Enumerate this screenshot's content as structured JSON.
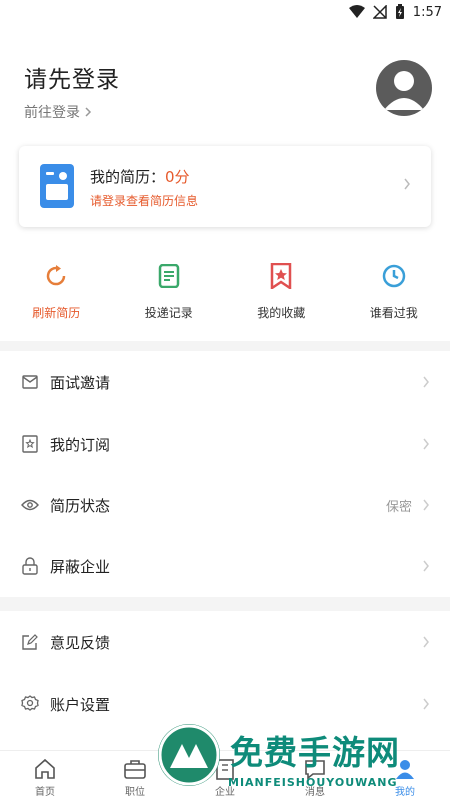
{
  "status_bar": {
    "time": "1:57",
    "icons": [
      "wifi-icon",
      "no-signal-icon",
      "battery-icon"
    ]
  },
  "header": {
    "title": "请先登录",
    "login_link": "前往登录"
  },
  "resume_card": {
    "title_prefix": "我的简历：",
    "score": "0分",
    "subtitle": "请登录查看简历信息"
  },
  "quick_actions": [
    {
      "label": "刷新简历",
      "icon": "refresh-icon",
      "color": "#e67e3a"
    },
    {
      "label": "投递记录",
      "icon": "document-icon",
      "color": "#3aa86a"
    },
    {
      "label": "我的收藏",
      "icon": "bookmark-star-icon",
      "color": "#e05050"
    },
    {
      "label": "谁看过我",
      "icon": "clock-icon",
      "color": "#3a9fd8"
    }
  ],
  "menu_group1": [
    {
      "label": "面试邀请",
      "icon": "mail-icon",
      "value": ""
    },
    {
      "label": "我的订阅",
      "icon": "subscription-icon",
      "value": ""
    },
    {
      "label": "简历状态",
      "icon": "eye-icon",
      "value": "保密"
    },
    {
      "label": "屏蔽企业",
      "icon": "lock-icon",
      "value": ""
    }
  ],
  "menu_group2": [
    {
      "label": "意见反馈",
      "icon": "edit-icon",
      "value": ""
    },
    {
      "label": "账户设置",
      "icon": "settings-icon",
      "value": ""
    }
  ],
  "bottom_nav": [
    {
      "label": "首页",
      "icon": "home-icon"
    },
    {
      "label": "职位",
      "icon": "briefcase-icon"
    },
    {
      "label": "企业",
      "icon": "building-icon"
    },
    {
      "label": "消息",
      "icon": "message-icon"
    },
    {
      "label": "我的",
      "icon": "user-icon"
    }
  ],
  "watermark": {
    "title": "免费手游网",
    "subtitle": "MIANFEISHOUYOUWANG"
  },
  "colors": {
    "accent": "#e65a2c",
    "primary": "#3a8de8"
  }
}
